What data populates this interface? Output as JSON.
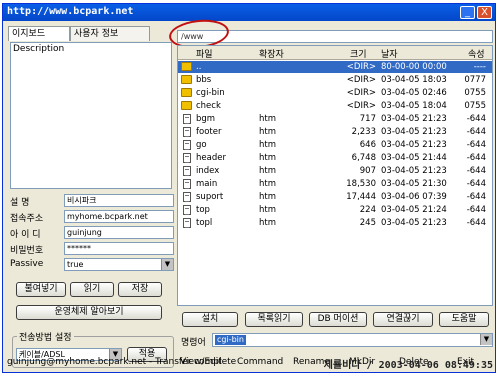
{
  "window": {
    "title": "http://www.bcpark.net",
    "minimize_glyph": "_",
    "close_glyph": "X"
  },
  "left_panel": {
    "tabs": [
      {
        "label": "이지보드"
      },
      {
        "label": "사용자 정보"
      }
    ],
    "description_label": "Description",
    "fields": [
      {
        "label": "설    명",
        "value": "비시파크"
      },
      {
        "label": "접속주소",
        "value": "myhome.bcpark.net"
      },
      {
        "label": "아 이 디",
        "value": "guinjung"
      },
      {
        "label": "비밀번호",
        "value": "******"
      },
      {
        "label": "Passive",
        "value": "true"
      }
    ],
    "buttons": [
      {
        "label": "불여넣기"
      },
      {
        "label": "읽기"
      },
      {
        "label": "저장"
      }
    ],
    "os_button": "운영체제 알아보기",
    "transfer_group": {
      "label": "전송방법 설정",
      "selected": "케이블/ADSL",
      "apply_button": "적용"
    }
  },
  "right_panel": {
    "path": "/www",
    "columns": [
      "파일",
      "확장자",
      "크기",
      "날자",
      "속성"
    ],
    "files": [
      {
        "icon": "folder-up-icon",
        "name": "..",
        "ext": "",
        "size": "<DIR>",
        "date": "80-00-00 00:00",
        "attr": "----",
        "selected": true
      },
      {
        "icon": "folder-icon",
        "name": "bbs",
        "ext": "",
        "size": "<DIR>",
        "date": "03-04-05 18:03",
        "attr": "0777"
      },
      {
        "icon": "folder-icon",
        "name": "cgi-bin",
        "ext": "",
        "size": "<DIR>",
        "date": "03-04-05 02:46",
        "attr": "0755"
      },
      {
        "icon": "folder-icon",
        "name": "check",
        "ext": "",
        "size": "<DIR>",
        "date": "03-04-05 18:04",
        "attr": "0755"
      },
      {
        "icon": "file-icon",
        "name": "bgm",
        "ext": "htm",
        "size": "717",
        "date": "03-04-05 21:23",
        "attr": "-644"
      },
      {
        "icon": "file-icon",
        "name": "footer",
        "ext": "htm",
        "size": "2,233",
        "date": "03-04-05 21:23",
        "attr": "-644"
      },
      {
        "icon": "file-icon",
        "name": "go",
        "ext": "htm",
        "size": "646",
        "date": "03-04-05 21:23",
        "attr": "-644"
      },
      {
        "icon": "file-icon",
        "name": "header",
        "ext": "htm",
        "size": "6,748",
        "date": "03-04-05 21:44",
        "attr": "-644"
      },
      {
        "icon": "file-icon",
        "name": "index",
        "ext": "htm",
        "size": "907",
        "date": "03-04-05 21:23",
        "attr": "-644"
      },
      {
        "icon": "file-icon",
        "name": "main",
        "ext": "htm",
        "size": "18,530",
        "date": "03-04-05 21:30",
        "attr": "-644"
      },
      {
        "icon": "file-icon",
        "name": "suport",
        "ext": "htm",
        "size": "17,444",
        "date": "03-04-06 07:39",
        "attr": "-644"
      },
      {
        "icon": "file-icon",
        "name": "top",
        "ext": "htm",
        "size": "224",
        "date": "03-04-05 21:24",
        "attr": "-644"
      },
      {
        "icon": "file-icon",
        "name": "topl",
        "ext": "htm",
        "size": "245",
        "date": "03-04-05 21:23",
        "attr": "-644"
      }
    ],
    "action_buttons": [
      {
        "label": "설치"
      },
      {
        "label": "목록읽기"
      },
      {
        "label": "DB 머이션"
      },
      {
        "label": "연결끊기"
      },
      {
        "label": "도움말"
      }
    ],
    "command": {
      "label": "명령어",
      "value": "cgi-bin"
    },
    "function_bar": [
      "View/Edit",
      "Command",
      "Rename",
      "MkDir",
      "Delete",
      "Exit"
    ]
  },
  "status": {
    "text": "guinjung@myhome.bcpark.net - Transfer complete",
    "overlay": "제룔비다 / 2003-04-06 08:49:35"
  },
  "colors": {
    "titlebar": "#0a5fe6",
    "selection": "#316ac5",
    "annotation_circle": "#c01010"
  }
}
